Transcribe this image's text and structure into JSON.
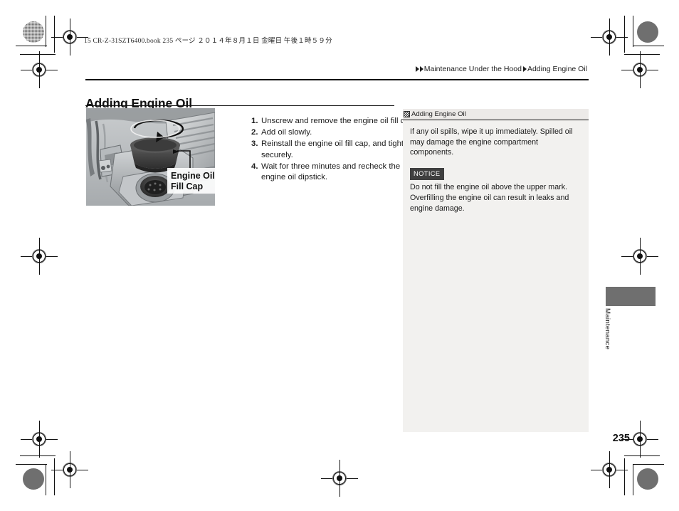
{
  "print": {
    "file_stamp": "15 CR-Z-31SZT6400.book   235 ページ   ２０１４年８月１日   金曜日   午後１時５９分"
  },
  "breadcrumb": {
    "section": "Maintenance Under the Hood",
    "topic": "Adding Engine Oil"
  },
  "page": {
    "title": "Adding Engine Oil",
    "folio": "235"
  },
  "figure": {
    "caption_line1": "Engine Oil",
    "caption_line2": "Fill Cap",
    "alt": "engine-bay-oil-fill-cap-illustration"
  },
  "steps": [
    {
      "num": "1.",
      "text": "Unscrew and remove the engine oil fill cap."
    },
    {
      "num": "2.",
      "text": "Add oil slowly."
    },
    {
      "num": "3.",
      "text": "Reinstall the engine oil fill cap, and tighten it securely."
    },
    {
      "num": "4.",
      "text": "Wait for three minutes and recheck the engine oil dipstick."
    }
  ],
  "note_panel": {
    "heading": "Adding Engine Oil",
    "paragraph": "If any oil spills, wipe it up immediately. Spilled oil may damage the engine compartment components.",
    "notice_label": "NOTICE",
    "notice_text": "Do not fill the engine oil above the upper mark. Overfilling the engine oil can result in leaks and engine damage."
  },
  "side_tab": {
    "label": "Maintenance"
  },
  "colors": {
    "note_panel_bg": "#f2f1ef",
    "note_head_bg": "#eceae8",
    "notice_badge_bg": "#3f3f3f",
    "tab_block": "#6f6f6f",
    "text": "#1c1c1c"
  }
}
